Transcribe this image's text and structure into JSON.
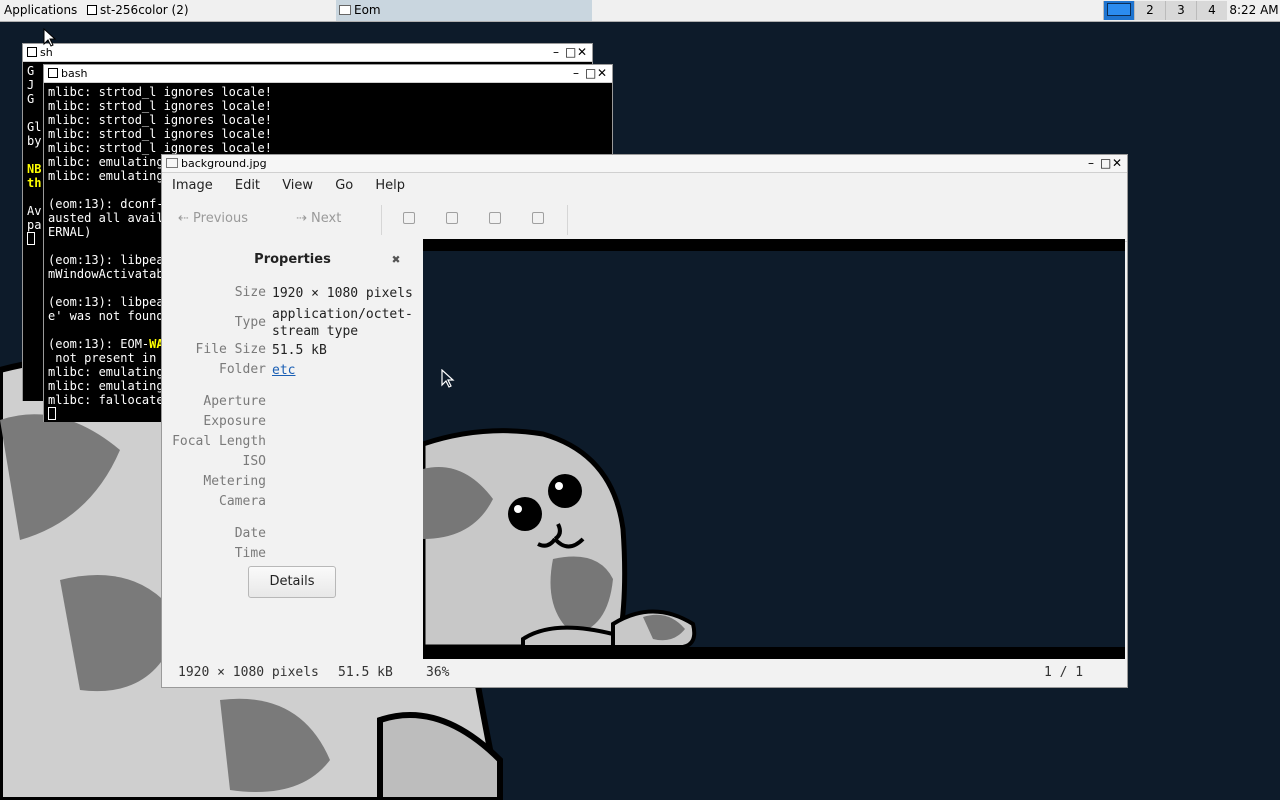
{
  "panel": {
    "applications": "Applications",
    "task1": "st-256color (2)",
    "task2": "Eom",
    "workspaces": [
      "2",
      "3",
      "4"
    ],
    "clock": "8:22 AM"
  },
  "sh_window": {
    "title": "sh",
    "lines": [
      "G",
      "J",
      "G",
      "",
      "Gl",
      "by",
      "",
      "NB",
      "th",
      "",
      "Av",
      "pa"
    ]
  },
  "bash_window": {
    "title": "bash",
    "lines": [
      "mlibc: strtod_l ignores locale!",
      "mlibc: strtod_l ignores locale!",
      "mlibc: strtod_l ignores locale!",
      "mlibc: strtod_l ignores locale!",
      "mlibc: strtod_l ignores locale!",
      "mlibc: emulating",
      "mlibc: emulating",
      "",
      "(eom:13): dconf-",
      "austed all avail",
      "ERNAL)",
      "",
      "(eom:13): libpea",
      "mWindowActivatab",
      "",
      "(eom:13): libpea",
      "e' was not found",
      "",
      "(eom:13): EOM-WA",
      " not present in",
      "mlibc: emulating",
      "mlibc: emulating",
      "mlibc: fallocate"
    ]
  },
  "eom": {
    "title": "background.jpg",
    "menu": [
      "Image",
      "Edit",
      "View",
      "Go",
      "Help"
    ],
    "toolbar": {
      "previous": "Previous",
      "next": "Next"
    },
    "properties": {
      "title": "Properties",
      "size_label": "Size",
      "size_value": "1920 × 1080 pixels",
      "type_label": "Type",
      "type_value": "application/octet-\nstream type",
      "filesize_label": "File Size",
      "filesize_value": "51.5 kB",
      "folder_label": "Folder",
      "folder_value": "etc",
      "aperture_label": "Aperture",
      "exposure_label": "Exposure",
      "focal_label": "Focal Length",
      "iso_label": "ISO",
      "metering_label": "Metering",
      "camera_label": "Camera",
      "date_label": "Date",
      "time_label": "Time",
      "details_button": "Details"
    },
    "status": {
      "dimensions": "1920 × 1080 pixels",
      "filesize": "51.5 kB",
      "zoom": "36%",
      "position": "1 / 1"
    }
  }
}
